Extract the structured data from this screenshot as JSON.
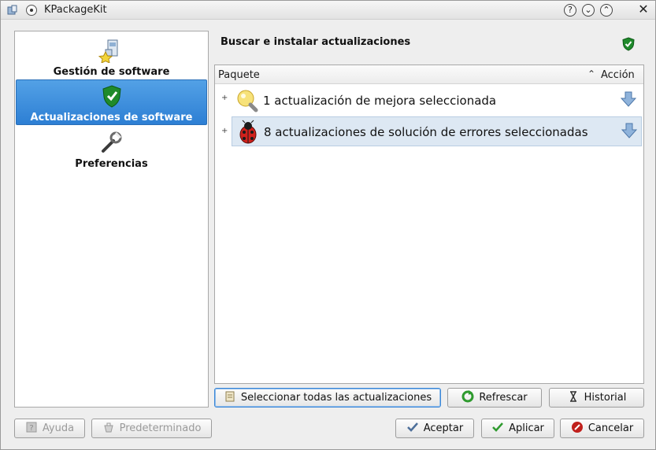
{
  "window": {
    "title": "KPackageKit",
    "controls": {
      "help": "?",
      "minimize": "⌄",
      "maximize": "⌃",
      "close": "✕"
    }
  },
  "sidebar": {
    "items": [
      {
        "label": "Gestión de software",
        "icon": "software-management-icon",
        "selected": false
      },
      {
        "label": "Actualizaciones de software",
        "icon": "shield-check-icon",
        "selected": true
      },
      {
        "label": "Preferencias",
        "icon": "wrench-icon",
        "selected": false
      }
    ]
  },
  "main": {
    "title": "Buscar e instalar actualizaciones",
    "table": {
      "columns": {
        "package": "Paquete",
        "action": "Acción"
      },
      "sort_indicator": "⌃",
      "rows": [
        {
          "text": "1 actualización de mejora seleccionada",
          "icon": "lightbulb-icon",
          "expander": "+"
        },
        {
          "text": "8 actualizaciones de solución de errores seleccionadas",
          "icon": "ladybug-icon",
          "expander": "+"
        }
      ]
    },
    "buttons": {
      "select_all": "Seleccionar todas las actualizaciones",
      "refresh": "Refrescar",
      "history": "Historial"
    }
  },
  "footer": {
    "help": "Ayuda",
    "defaults": "Predeterminado",
    "ok": "Aceptar",
    "apply": "Aplicar",
    "cancel": "Cancelar"
  },
  "colors": {
    "selection": "#3a8ddb",
    "accent_green": "#2e9a2e",
    "cancel_red": "#c0201c"
  }
}
